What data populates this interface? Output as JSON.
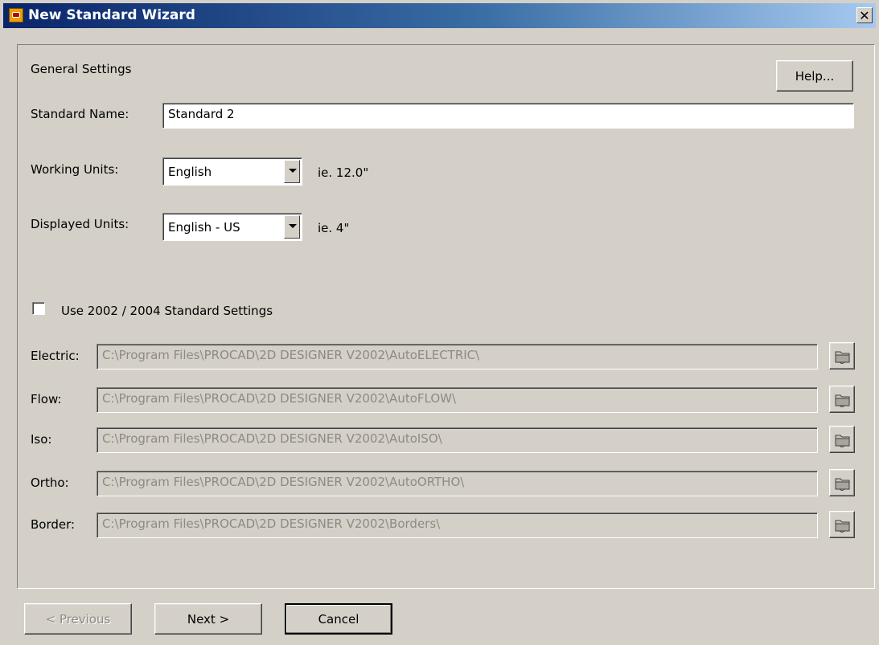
{
  "window": {
    "title": "New Standard Wizard",
    "close_label": "✕"
  },
  "header": {
    "section_title": "General Settings",
    "help_label": "Help..."
  },
  "fields": {
    "standard_name": {
      "label": "Standard Name:",
      "value": "Standard 2"
    },
    "working_units": {
      "label": "Working Units:",
      "value": "English",
      "example": "ie. 12.0\""
    },
    "displayed_units": {
      "label": "Displayed Units:",
      "value": "English - US",
      "example": "ie. 4\""
    }
  },
  "legacy": {
    "checkbox_label": "Use 2002 / 2004 Standard Settings",
    "checked": false
  },
  "paths": [
    {
      "label": "Electric:",
      "value": "C:\\Program Files\\PROCAD\\2D DESIGNER V2002\\AutoELECTRIC\\"
    },
    {
      "label": "Flow:",
      "value": "C:\\Program Files\\PROCAD\\2D DESIGNER V2002\\AutoFLOW\\"
    },
    {
      "label": "Iso:",
      "value": "C:\\Program Files\\PROCAD\\2D DESIGNER V2002\\AutoISO\\"
    },
    {
      "label": "Ortho:",
      "value": "C:\\Program Files\\PROCAD\\2D DESIGNER V2002\\AutoORTHO\\"
    },
    {
      "label": "Border:",
      "value": "C:\\Program Files\\PROCAD\\2D DESIGNER V2002\\Borders\\"
    }
  ],
  "footer": {
    "previous_label": "< Previous",
    "next_label": "Next >",
    "cancel_label": "Cancel"
  },
  "colors": {
    "face": "#d4d0c8",
    "title_start": "#0a246a",
    "title_end": "#a6caf0",
    "disabled_text": "#8d8a84"
  }
}
